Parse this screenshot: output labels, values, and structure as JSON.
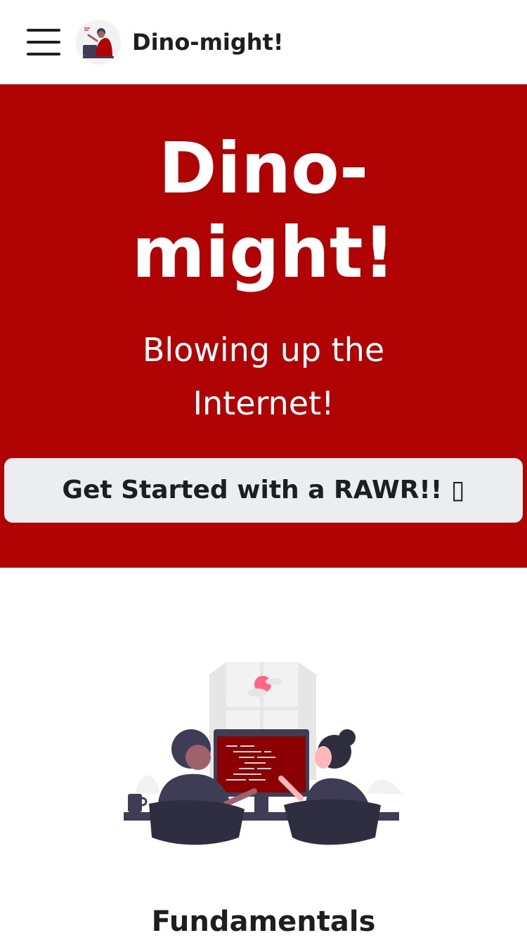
{
  "navbar": {
    "menu_icon": "hamburger-menu-icon",
    "logo_icon": "person-at-laptop-logo",
    "brand_title": "Dino-might!"
  },
  "hero": {
    "title_lines": [
      "Dino-",
      "might!"
    ],
    "subtitle_lines": [
      "Blowing up the",
      "Internet!"
    ],
    "cta_label": "Get Started with a RAWR!! ▯",
    "background_color": "#b00404",
    "text_color": "#ffffff",
    "button_color": "#ebedf0"
  },
  "features": {
    "illustration_icon": "two-people-coding-illustration",
    "section_title": "Fundamentals"
  }
}
